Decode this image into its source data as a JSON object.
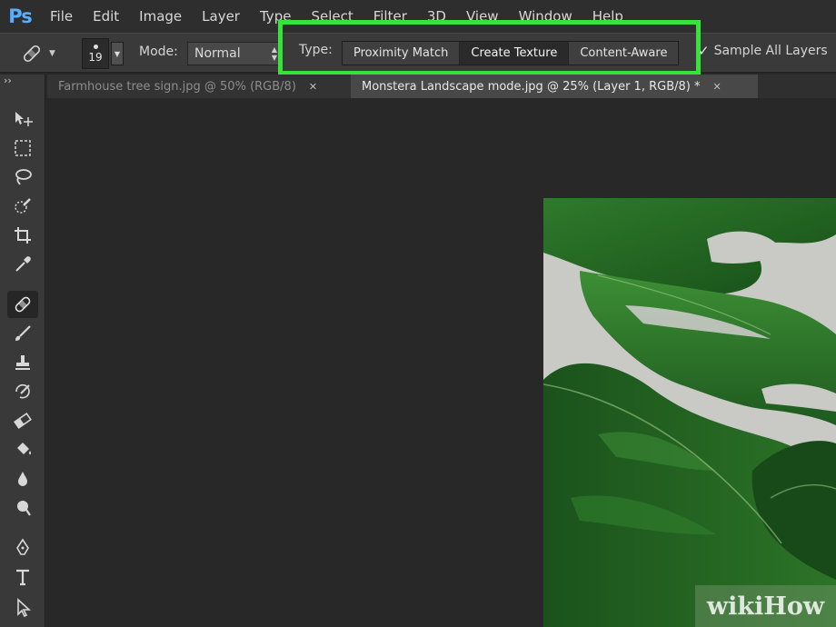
{
  "app": {
    "logo": "Ps"
  },
  "menu": [
    "File",
    "Edit",
    "Image",
    "Layer",
    "Type",
    "Select",
    "Filter",
    "3D",
    "View",
    "Window",
    "Help"
  ],
  "options_bar": {
    "brush_size": "19",
    "mode_label": "Mode:",
    "mode_value": "Normal",
    "type_label": "Type:",
    "type_buttons": [
      "Proximity Match",
      "Create Texture",
      "Content-Aware"
    ],
    "selected_type": "Create Texture",
    "sample_all_layers": "Sample All Layers",
    "sample_all_checked": true
  },
  "tabs": [
    {
      "title": "Farmhouse tree sign.jpg @ 50% (RGB/8)",
      "active": false
    },
    {
      "title": "Monstera Landscape mode.jpg @ 25% (Layer 1, RGB/8) *",
      "active": true
    }
  ],
  "tools": [
    "move-tool",
    "marquee-tool",
    "lasso-tool",
    "quick-selection-tool",
    "crop-tool",
    "eyedropper-tool",
    "spot-healing-brush-tool",
    "brush-tool",
    "clone-stamp-tool",
    "history-brush-tool",
    "eraser-tool",
    "paint-bucket-tool",
    "blur-tool",
    "dodge-tool",
    "pen-tool",
    "type-tool",
    "path-selection-tool"
  ],
  "active_tool": "spot-healing-brush-tool",
  "highlight_color": "#35e33a",
  "watermark": "wikiHow"
}
